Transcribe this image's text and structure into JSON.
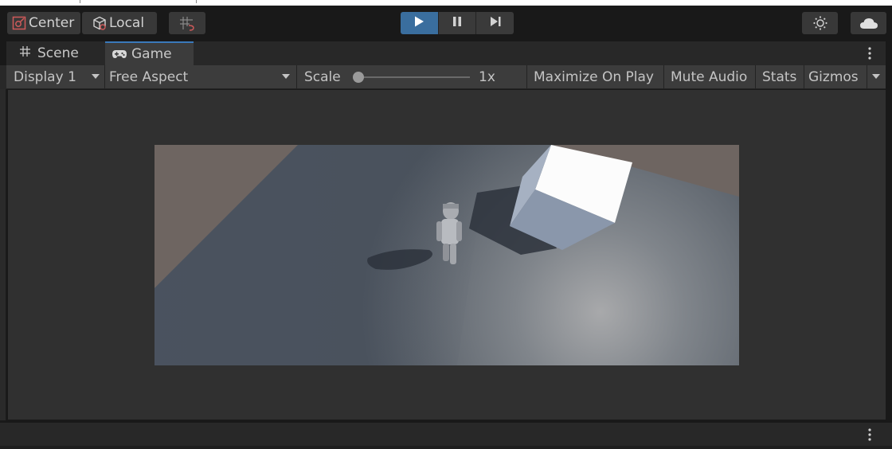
{
  "toolbar": {
    "pivot_label": "Center",
    "space_label": "Local",
    "pivot_icon": "pivot-center-icon",
    "space_icon": "local-cube-icon",
    "grid_snap_icon": "grid-snap-icon",
    "play_icon": "play-icon",
    "pause_icon": "pause-icon",
    "step_icon": "step-icon",
    "lighting_icon": "light-icon",
    "cloud_icon": "cloud-icon",
    "accent_color": "#3a6e9e"
  },
  "tabs": [
    {
      "label": "Scene",
      "icon": "hash-icon",
      "active": false
    },
    {
      "label": "Game",
      "icon": "gamepad-icon",
      "active": true
    }
  ],
  "game_options": {
    "display": "Display 1",
    "aspect": "Free Aspect",
    "scale_label": "Scale",
    "scale_value": "1x",
    "scale_fraction": 0.0,
    "maximize_on_play": "Maximize On Play",
    "mute_audio": "Mute Audio",
    "stats": "Stats",
    "gizmos": "Gizmos"
  }
}
